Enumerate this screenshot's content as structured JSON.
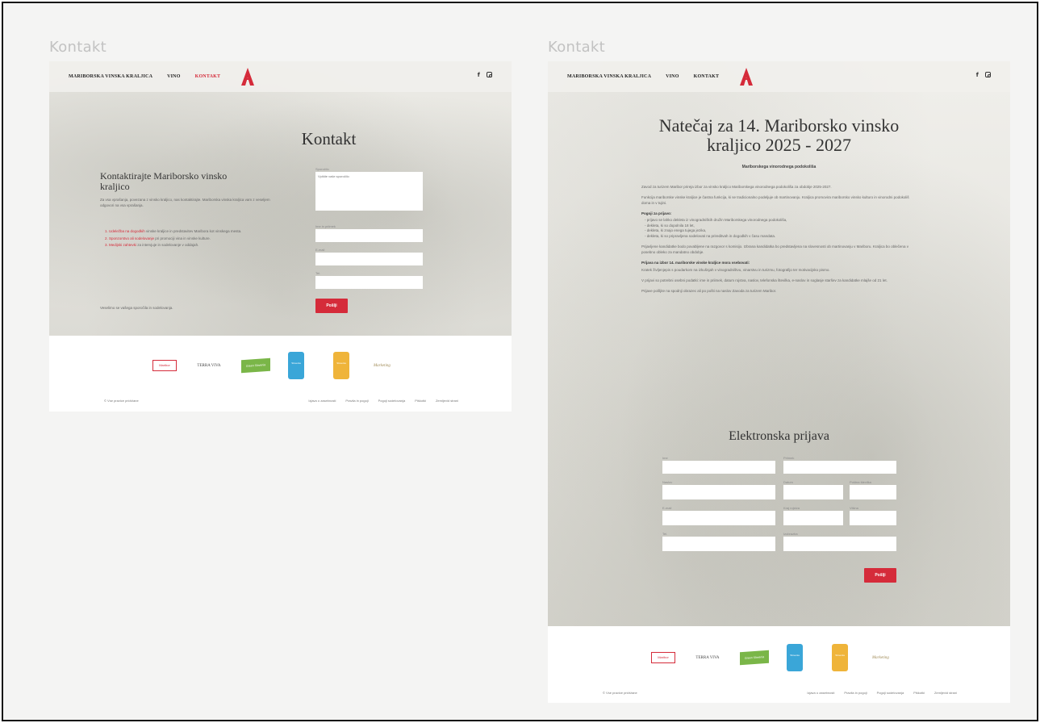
{
  "left_label": "Kontakt",
  "right_label": "Kontakt",
  "nav": {
    "brand": "MARIBORSKA VINSKA KRALJICA",
    "wine": "VINO",
    "contact": "KONTAKT",
    "facebook": "f"
  },
  "left": {
    "title": "Kontakt",
    "heading": "Kontaktirajte Mariborsko vinsko kraljico",
    "intro": "Za vsa vprašanja, povezana z vinsko kraljico, nas kontaktirajte. Mariborska vinska kraljica vam z veseljem odgovori na vsa vprašanja.",
    "list": [
      {
        "red": "1. Udeležba na dogodkih",
        "text": " vinske kraljice in predstavitev Maribora kot vinskega mesta."
      },
      {
        "red": "2. Sponzorstvo ali sodelovanje",
        "text": " pri promociji vina in vinske kulture."
      },
      {
        "red": "3. Medijski zahtevki",
        "text": " za intervjuje in sodelovanje v oddajah."
      }
    ],
    "footnote": "Veselimo se vašega sporočila in sodelovanja.",
    "form_labels": [
      "Sporočilo",
      "Ime in priimek",
      "E-mail",
      "Tel."
    ],
    "message_placeholder": "Vpišite vaše sporočilo",
    "submit": "Pošlji"
  },
  "right": {
    "title": "Natečaj za 14. Mariborsko vinsko kraljico 2025 - 2027",
    "subtitle": "Mariborskega vinorodnega podokoliša",
    "para1": "Zavod za turizem Maribor prireja izbor za vinsko kraljico Mariborskega vinorodnega podokoliša za obdobje 2025-2027.",
    "para2": "Funkcija mariborske vinske kraljice je častna funkcija, ki se tradicionalno podeljuje ob martinovanju. Kraljica promovira mariborsko vinsko kulturo in vinorodni podokoliš doma in v tujini.",
    "cond_heading": "Pogoji za prijavo:",
    "conditions": [
      "- prijavo se lahko dekleta iz vinogradniških družin Mariborskega vinorodnega podokoliša,",
      "- dekleta, ki so dopolnila 18 let,",
      "- dekleta, ki znajo enega tujega jezika,",
      "- dekleta, ki so pripravljena sodelovati na prireditvah in dogodkih v času mandata."
    ],
    "para3": "Prijavljene kandidatke bodo povabljene na razgovor s komisijo. Izbrana kandidatka bo predstavljena na slovesnosti ob martinovanju v Mariboru. Kraljica bo oblečena v posebno obleko za mandatno obdobje.",
    "apply_heading": "Prijava na izbor 14. mariborske vinske kraljice mora vsebovati:",
    "para4": "Kratek življenjepis s poudarkom na izkušnjah v vinogradništvu, vinarstvu in turizmu, fotografijo ter motivacijsko pismo.",
    "para5": "V prijavi so potrebni osebni podatki: ime in priimek, datum rojstva, naslov, telefonska številka, e-naslov in soglasje staršev za kandidatke mlajše od 21 let.",
    "para6": "Prijave pošljite na spodnji obrazec ali po pošti na naslov Zavoda za turizem Maribor.",
    "form_title": "Elektronska prijava",
    "form_labels": [
      "Ime",
      "Priimek",
      "Naslov",
      "Datum",
      "Poštna številka",
      "E-mail",
      "Kraj rojstva",
      "Višina",
      "Tel.",
      "Izobrazba"
    ],
    "submit": "Pošlji"
  },
  "footer": {
    "sponsors": [
      "Maribor",
      "TERRA VIVA",
      "Green Slovenia",
      "Slovenia",
      "Slovenia",
      "Marketing"
    ],
    "copyright": "© Vse pravice pridržane",
    "links": [
      "Izjava o zasebnosti",
      "Pravila in pogoji",
      "Pogoji sodelovanja",
      "Piškotki",
      "Zemljevid strani"
    ]
  },
  "colors": {
    "accent": "#d52b3a",
    "blue_badge": "#3aa6d8",
    "yellow_badge": "#efb43a",
    "green_badge": "#7ab648"
  }
}
